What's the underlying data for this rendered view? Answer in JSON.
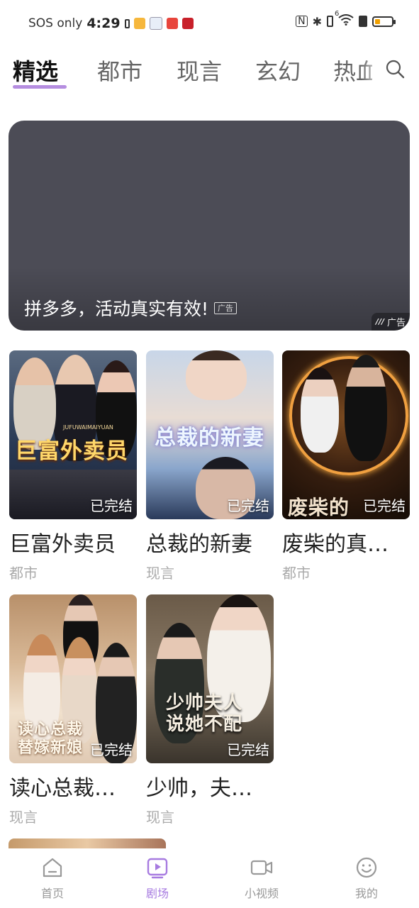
{
  "statusbar": {
    "carrier": "SOS only",
    "time": "4:29",
    "network_label": "6"
  },
  "tabs": [
    {
      "label": "精选",
      "active": true
    },
    {
      "label": "都市",
      "active": false
    },
    {
      "label": "现言",
      "active": false
    },
    {
      "label": "玄幻",
      "active": false
    },
    {
      "label": "热血",
      "active": false
    }
  ],
  "search": {
    "icon": "search-icon"
  },
  "banner": {
    "text": "拼多多，活动真实有效!",
    "ad_chip": "广告",
    "ad_corner": "广告"
  },
  "dramas": [
    {
      "title": "巨富外卖员",
      "genre": "都市",
      "status": "已完结",
      "poster_title": "巨富外卖员",
      "poster_sub": "JUFUWAIMAIYUAN",
      "colors": [
        "#2a3a55",
        "#7a8aa0",
        "#c8a66a"
      ]
    },
    {
      "title": "总裁的新妻",
      "genre": "现言",
      "status": "已完结",
      "poster_title": "总裁的新妻",
      "poster_sub": "",
      "colors": [
        "#9fb6d6",
        "#e6dcd6",
        "#3a4a66"
      ]
    },
    {
      "title": "废柴的真…",
      "genre": "都市",
      "status": "已完结",
      "poster_title": "废柴的",
      "poster_sub": "",
      "colors": [
        "#2a1a10",
        "#b8701a",
        "#5a3a22"
      ]
    },
    {
      "title": "读心总裁…",
      "genre": "现言",
      "status": "已完结",
      "poster_title": "读心总裁替嫁新娘",
      "poster_sub": "",
      "colors": [
        "#c9a37a",
        "#f1e3d2",
        "#6a5040"
      ]
    },
    {
      "title": "少帅，夫…",
      "genre": "现言",
      "status": "已完结",
      "poster_title": "少帅夫人说她不配",
      "poster_sub": "",
      "colors": [
        "#5a4a3a",
        "#c8b8a0",
        "#2a2a26"
      ]
    }
  ],
  "bottom_nav": [
    {
      "label": "首页",
      "icon": "home-icon",
      "active": false
    },
    {
      "label": "剧场",
      "icon": "theater-play-icon",
      "active": true
    },
    {
      "label": "小视频",
      "icon": "video-camera-icon",
      "active": false
    },
    {
      "label": "我的",
      "icon": "smiley-profile-icon",
      "active": false
    }
  ],
  "colors": {
    "accent": "#a77be0",
    "banner_bg": "#4c4c56",
    "tab_underline": "#b58de0"
  }
}
